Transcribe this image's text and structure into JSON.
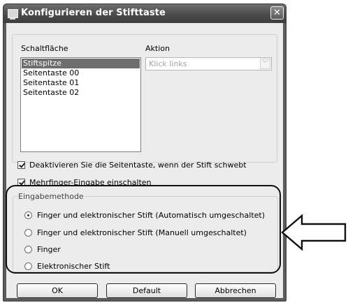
{
  "window": {
    "title": "Konfigurieren der Stifttaste",
    "close_label": "✕"
  },
  "schaltflaeche": {
    "label": "Schaltfläche",
    "items": [
      "Stiftspitze",
      "Seitentaste 00",
      "Seitentaste 01",
      "Seitentaste 02"
    ],
    "selected_index": 0
  },
  "aktion": {
    "label": "Aktion",
    "value": "Klick links",
    "disabled": true
  },
  "options": {
    "hover_disable": {
      "label": "Deaktivieren Sie die Seitentaste, wenn der Stift schwebt",
      "checked": true
    },
    "multitouch": {
      "label": "Mehrfinger-Eingabe einschalten",
      "checked": true
    }
  },
  "eingabemethode": {
    "legend": "Eingabemethode",
    "choices": [
      {
        "label": "Finger und elektronischer Stift (Automatisch umgeschaltet)",
        "selected": true
      },
      {
        "label": "Finger und elektronischer Stift (Manuell umgeschaltet)",
        "selected": false
      },
      {
        "label": "Finger",
        "selected": false
      },
      {
        "label": "Elektronischer Stift",
        "selected": false
      }
    ]
  },
  "buttons": {
    "ok": "OK",
    "default": "Default",
    "cancel": "Abbrechen"
  }
}
